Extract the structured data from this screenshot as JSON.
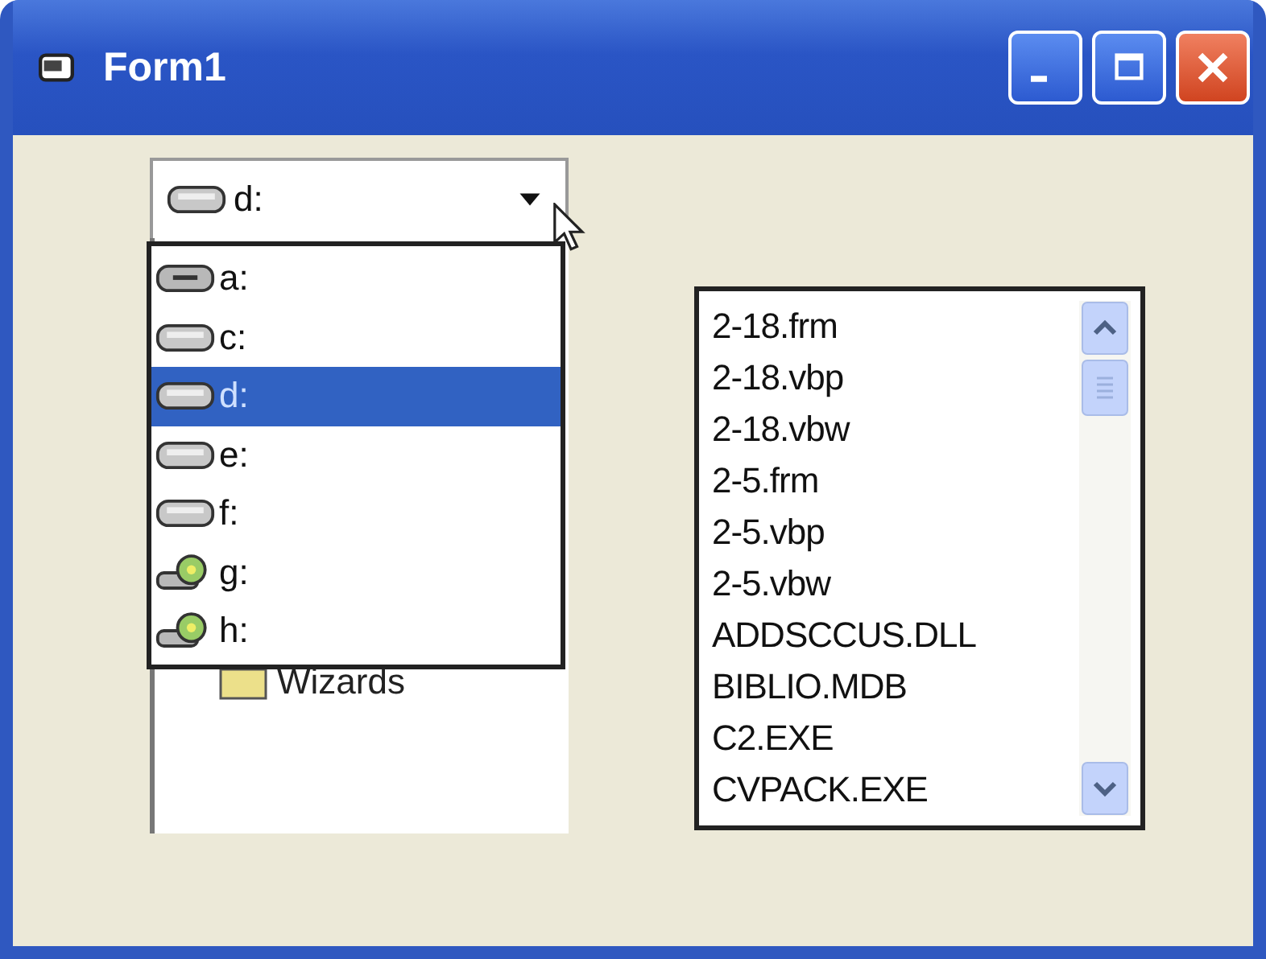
{
  "window": {
    "title": "Form1"
  },
  "drive_combo": {
    "value": "d:",
    "kind": "hdd"
  },
  "drive_dropdown": {
    "items": [
      {
        "label": "a:",
        "kind": "floppy",
        "selected": false
      },
      {
        "label": "c:",
        "kind": "hdd",
        "selected": false
      },
      {
        "label": "d:",
        "kind": "hdd",
        "selected": true
      },
      {
        "label": "e:",
        "kind": "hdd",
        "selected": false
      },
      {
        "label": "f:",
        "kind": "hdd",
        "selected": false
      },
      {
        "label": "g:",
        "kind": "cd",
        "selected": false
      },
      {
        "label": "h:",
        "kind": "cd",
        "selected": false
      }
    ]
  },
  "dir_list": {
    "items": [
      {
        "label": "Wizards"
      }
    ]
  },
  "file_list": {
    "items": [
      "2-18.frm",
      "2-18.vbp",
      "2-18.vbw",
      "2-5.frm",
      "2-5.vbp",
      "2-5.vbw",
      "ADDSCCUS.DLL",
      "BIBLIO.MDB",
      "C2.EXE",
      "CVPACK.EXE"
    ]
  }
}
